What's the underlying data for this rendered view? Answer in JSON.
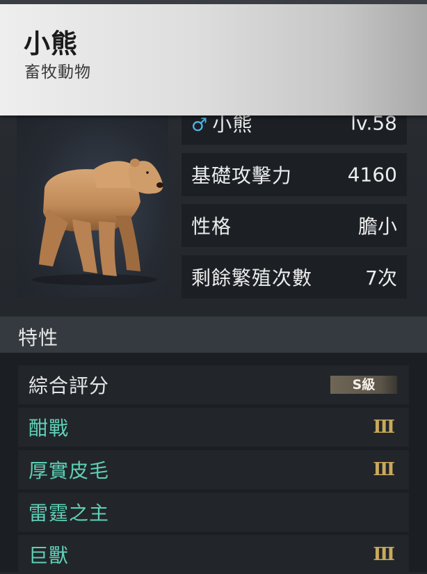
{
  "header": {
    "title": "小熊",
    "subtitle": "畜牧動物"
  },
  "stats": [
    {
      "label": "小熊",
      "value": "lv.58",
      "gender_symbol": "♂"
    },
    {
      "label": "基礎攻擊力",
      "value": "4160"
    },
    {
      "label": "性格",
      "value": "膽小"
    },
    {
      "label": "剩餘繁殖次數",
      "value": "7次"
    }
  ],
  "traits_section": {
    "title": "特性",
    "overall": {
      "label": "綜合評分",
      "grade": "S級"
    },
    "items": [
      {
        "name": "酣戰",
        "rank": "Ⅲ"
      },
      {
        "name": "厚實皮毛",
        "rank": "Ⅲ"
      },
      {
        "name": "雷霆之主",
        "rank": ""
      },
      {
        "name": "巨獸",
        "rank": "Ⅲ"
      }
    ]
  },
  "colors": {
    "trait_name": "#5fd0b6",
    "rank_gold": "#c9a95a",
    "gender_blue": "#4fb7e6"
  }
}
